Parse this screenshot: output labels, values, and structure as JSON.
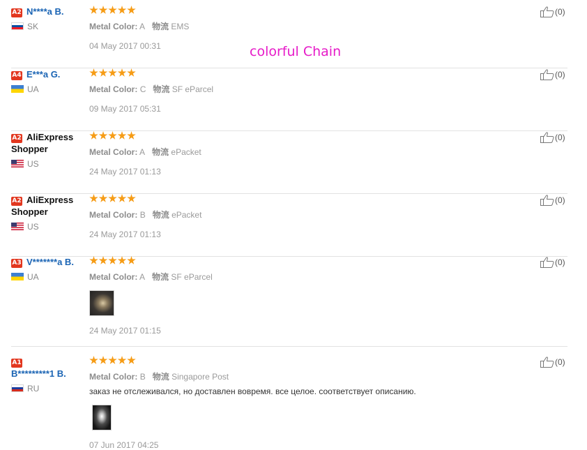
{
  "overlay_text": "colorful Chain",
  "labels": {
    "color_key": "Metal Color:",
    "shipping_key": "物流"
  },
  "colors": {
    "level_badge": "#e2371f",
    "username_link": "#1a64b4",
    "star": "#f69c16",
    "overlay": "#e61bc8"
  },
  "reviews": [
    {
      "level": "A2",
      "username": "N****a B.",
      "country": "SK",
      "flag": "flag-sk",
      "rating": 5,
      "metal_color": "A",
      "shipping": "EMS",
      "comment": "",
      "has_photo": false,
      "date": "04 May 2017 00:31",
      "likes": "(0)"
    },
    {
      "level": "A4",
      "username": "E***a G.",
      "country": "UA",
      "flag": "flag-ua",
      "rating": 5,
      "metal_color": "C",
      "shipping": "SF eParcel",
      "comment": "",
      "has_photo": false,
      "date": "09 May 2017 05:31",
      "likes": "(0)"
    },
    {
      "level": "A2",
      "username": "AliExpress Shopper",
      "country": "US",
      "flag": "flag-us",
      "rating": 5,
      "metal_color": "A",
      "shipping": "ePacket",
      "comment": "",
      "has_photo": false,
      "date": "24 May 2017 01:13",
      "likes": "(0)"
    },
    {
      "level": "A2",
      "username": "AliExpress Shopper",
      "country": "US",
      "flag": "flag-us",
      "rating": 5,
      "metal_color": "B",
      "shipping": "ePacket",
      "comment": "",
      "has_photo": false,
      "date": "24 May 2017 01:13",
      "likes": "(0)"
    },
    {
      "level": "A3",
      "username": "V*******a B.",
      "country": "UA",
      "flag": "flag-ua",
      "rating": 5,
      "metal_color": "A",
      "shipping": "SF eParcel",
      "comment": "",
      "has_photo": true,
      "date": "24 May 2017 01:15",
      "likes": "(0)"
    },
    {
      "level": "A1",
      "username": "B*********1 B.",
      "country": "RU",
      "flag": "flag-ru",
      "rating": 5,
      "metal_color": "B",
      "shipping": "Singapore Post",
      "comment": "заказ не отслеживался, но доставлен вовремя. все целое. соответствует описанию.",
      "has_photo": true,
      "date": "07 Jun 2017 04:25",
      "likes": "(0)"
    }
  ]
}
